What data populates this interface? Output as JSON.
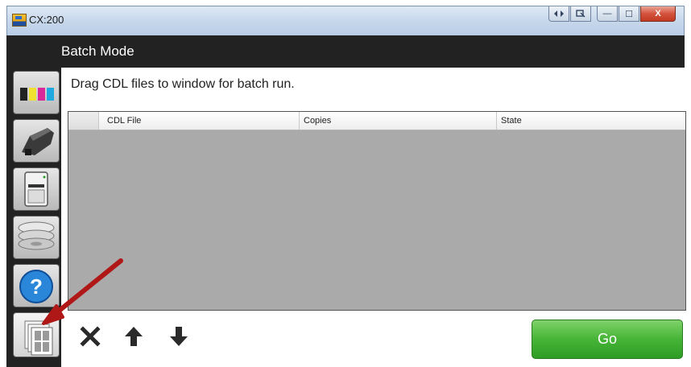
{
  "window": {
    "title": "CX:200",
    "minimize": "—",
    "maximize": "☐",
    "close": "X"
  },
  "header": {
    "title": "Batch Mode"
  },
  "main": {
    "instructions": "Drag CDL files to window for batch run.",
    "table": {
      "columns": [
        "CDL File",
        "Copies",
        "State"
      ],
      "rows": []
    },
    "go_label": "Go"
  },
  "sidebar": {
    "items": [
      {
        "icon": "ink-cartridges-icon"
      },
      {
        "icon": "printhead-icon"
      },
      {
        "icon": "printer-icon"
      },
      {
        "icon": "media-rolls-icon"
      },
      {
        "icon": "help-icon"
      },
      {
        "icon": "batch-mode-icon",
        "selected": true
      }
    ]
  },
  "toolbar": {
    "icons": [
      "remove-icon",
      "move-up-icon",
      "move-down-icon"
    ]
  },
  "colors": {
    "go_green": "#46b436",
    "annotation_red": "#cc2020",
    "grid_bg": "#aaaaaa",
    "frame_dark": "#222222"
  }
}
